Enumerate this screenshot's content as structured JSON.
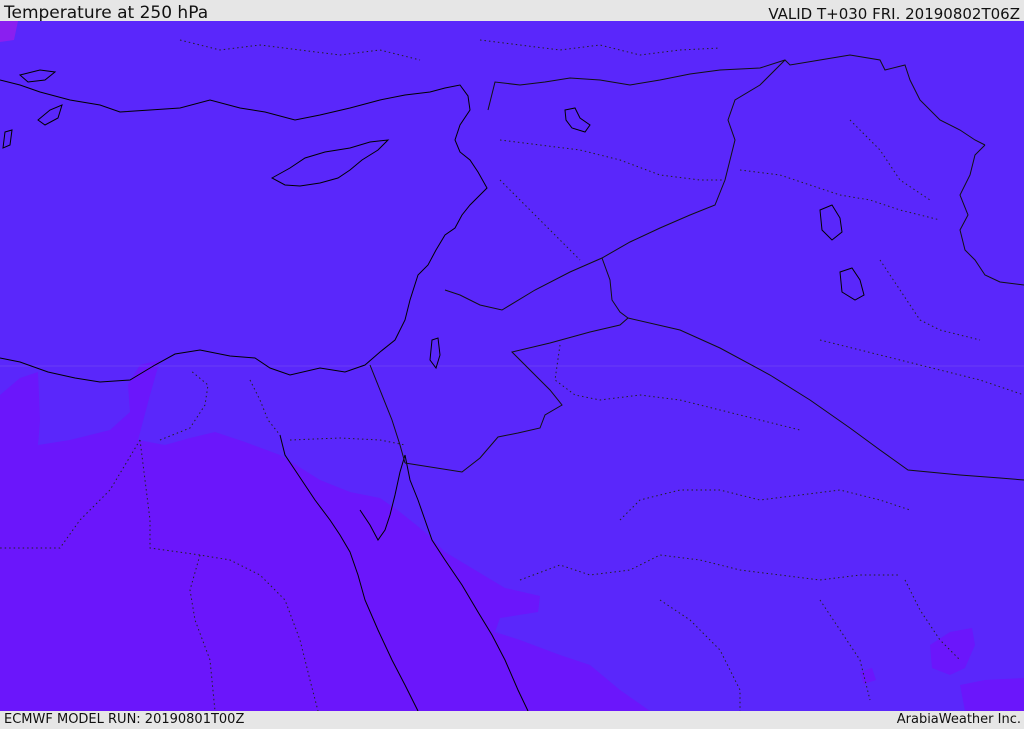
{
  "header": {
    "title": "Temperature at 250 hPa",
    "valid": "VALID T+030 FRI. 20190802T06Z"
  },
  "footer": {
    "model_run": "ECMWF MODEL RUN: 20190801T00Z",
    "credit": "ArabiaWeather Inc."
  },
  "map": {
    "field": "temperature",
    "level": "250 hPa",
    "colors": {
      "base_fill": "#5a27fb",
      "warm_fill": "#6b16fb",
      "pink_spot": "#c21fe0",
      "coastline": "#000000",
      "border": "#111111"
    }
  }
}
